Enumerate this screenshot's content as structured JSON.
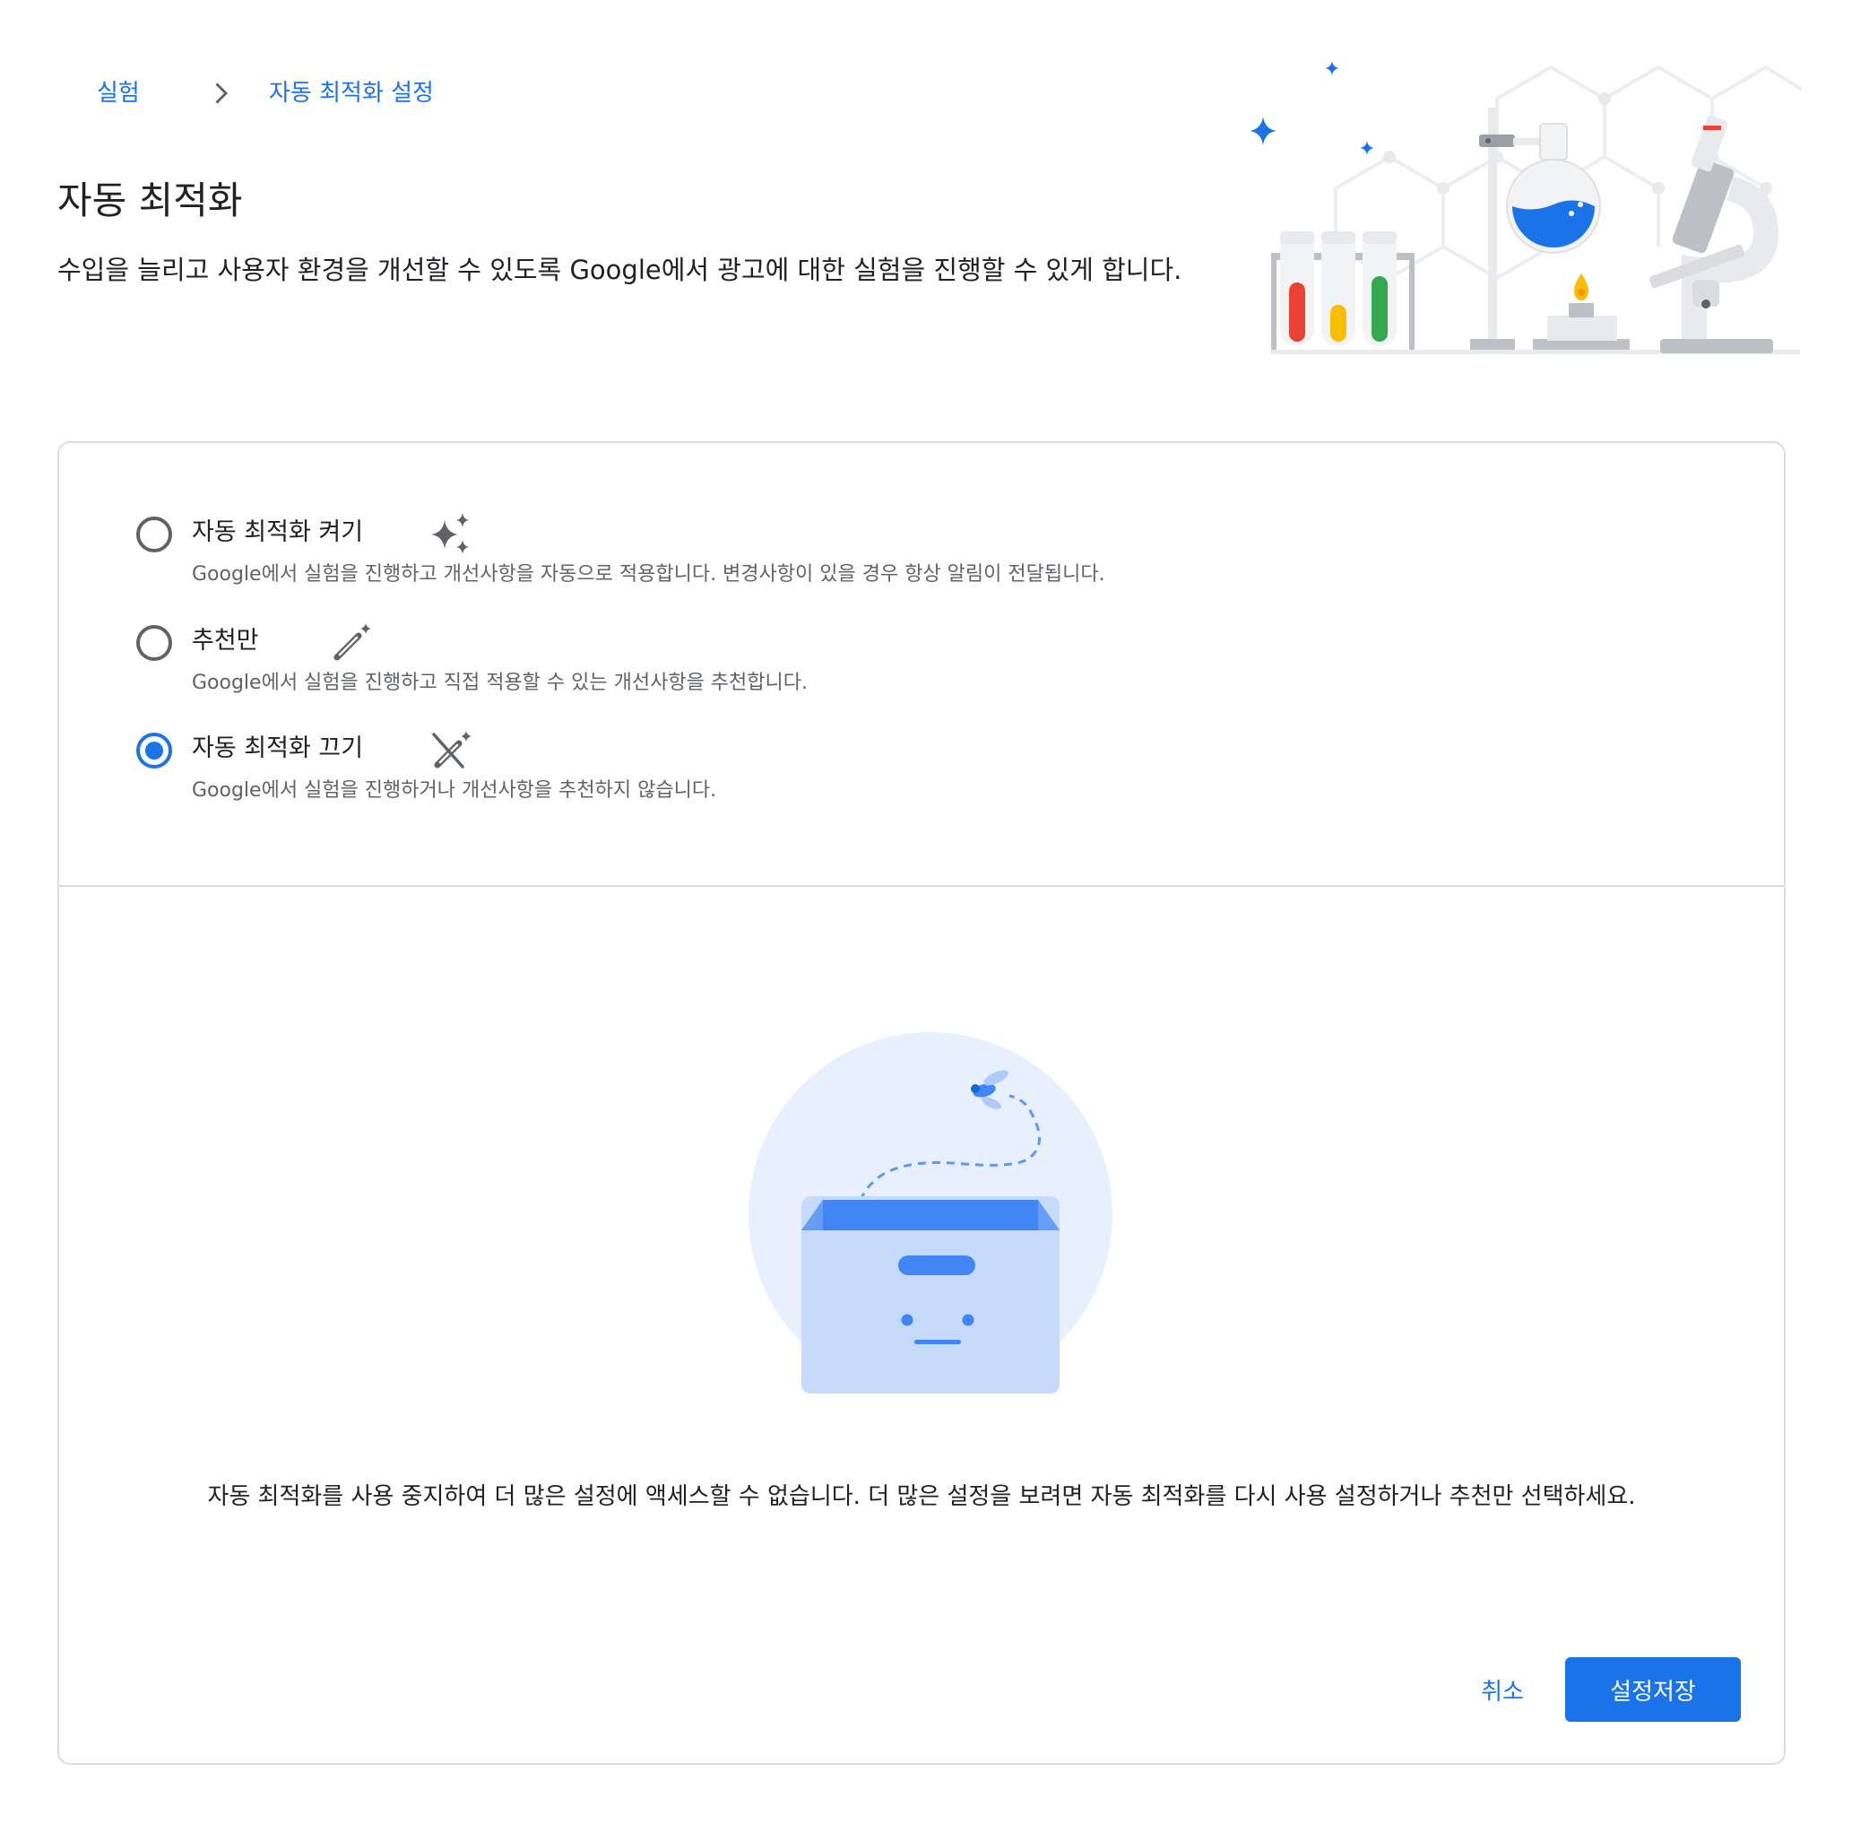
{
  "breadcrumb": {
    "items": [
      "실험",
      "자동 최적화 설정"
    ]
  },
  "header": {
    "title": "자동 최적화",
    "description": "수입을 늘리고 사용자 환경을 개선할 수 있도록 Google에서 광고에 대한 실험을 진행할 수 있게 합니다."
  },
  "options": [
    {
      "label": "자동 최적화 켜기",
      "description": "Google에서 실험을 진행하고 개선사항을 자동으로 적용합니다. 변경사항이 있을 경우 항상 알림이 전달됩니다.",
      "icon": "sparkle-icon",
      "selected": false
    },
    {
      "label": "추천만",
      "description": "Google에서 실험을 진행하고 직접 적용할 수 있는 개선사항을 추천합니다.",
      "icon": "magic-wand-icon",
      "selected": false
    },
    {
      "label": "자동 최적화 끄기",
      "description": "Google에서 실험을 진행하거나 개선사항을 추천하지 않습니다.",
      "icon": "magic-wand-off-icon",
      "selected": true
    }
  ],
  "empty_state": {
    "message": "자동 최적화를 사용 중지하여 더 많은 설정에 액세스할 수 없습니다. 더 많은 설정을 보려면 자동 최적화를 다시 사용 설정하거나 추천만 선택하세요."
  },
  "actions": {
    "cancel_label": "취소",
    "save_label": "설정저장"
  },
  "colors": {
    "accent": "#1a73e8",
    "border": "#dadce0",
    "text_secondary": "#5f6368"
  }
}
